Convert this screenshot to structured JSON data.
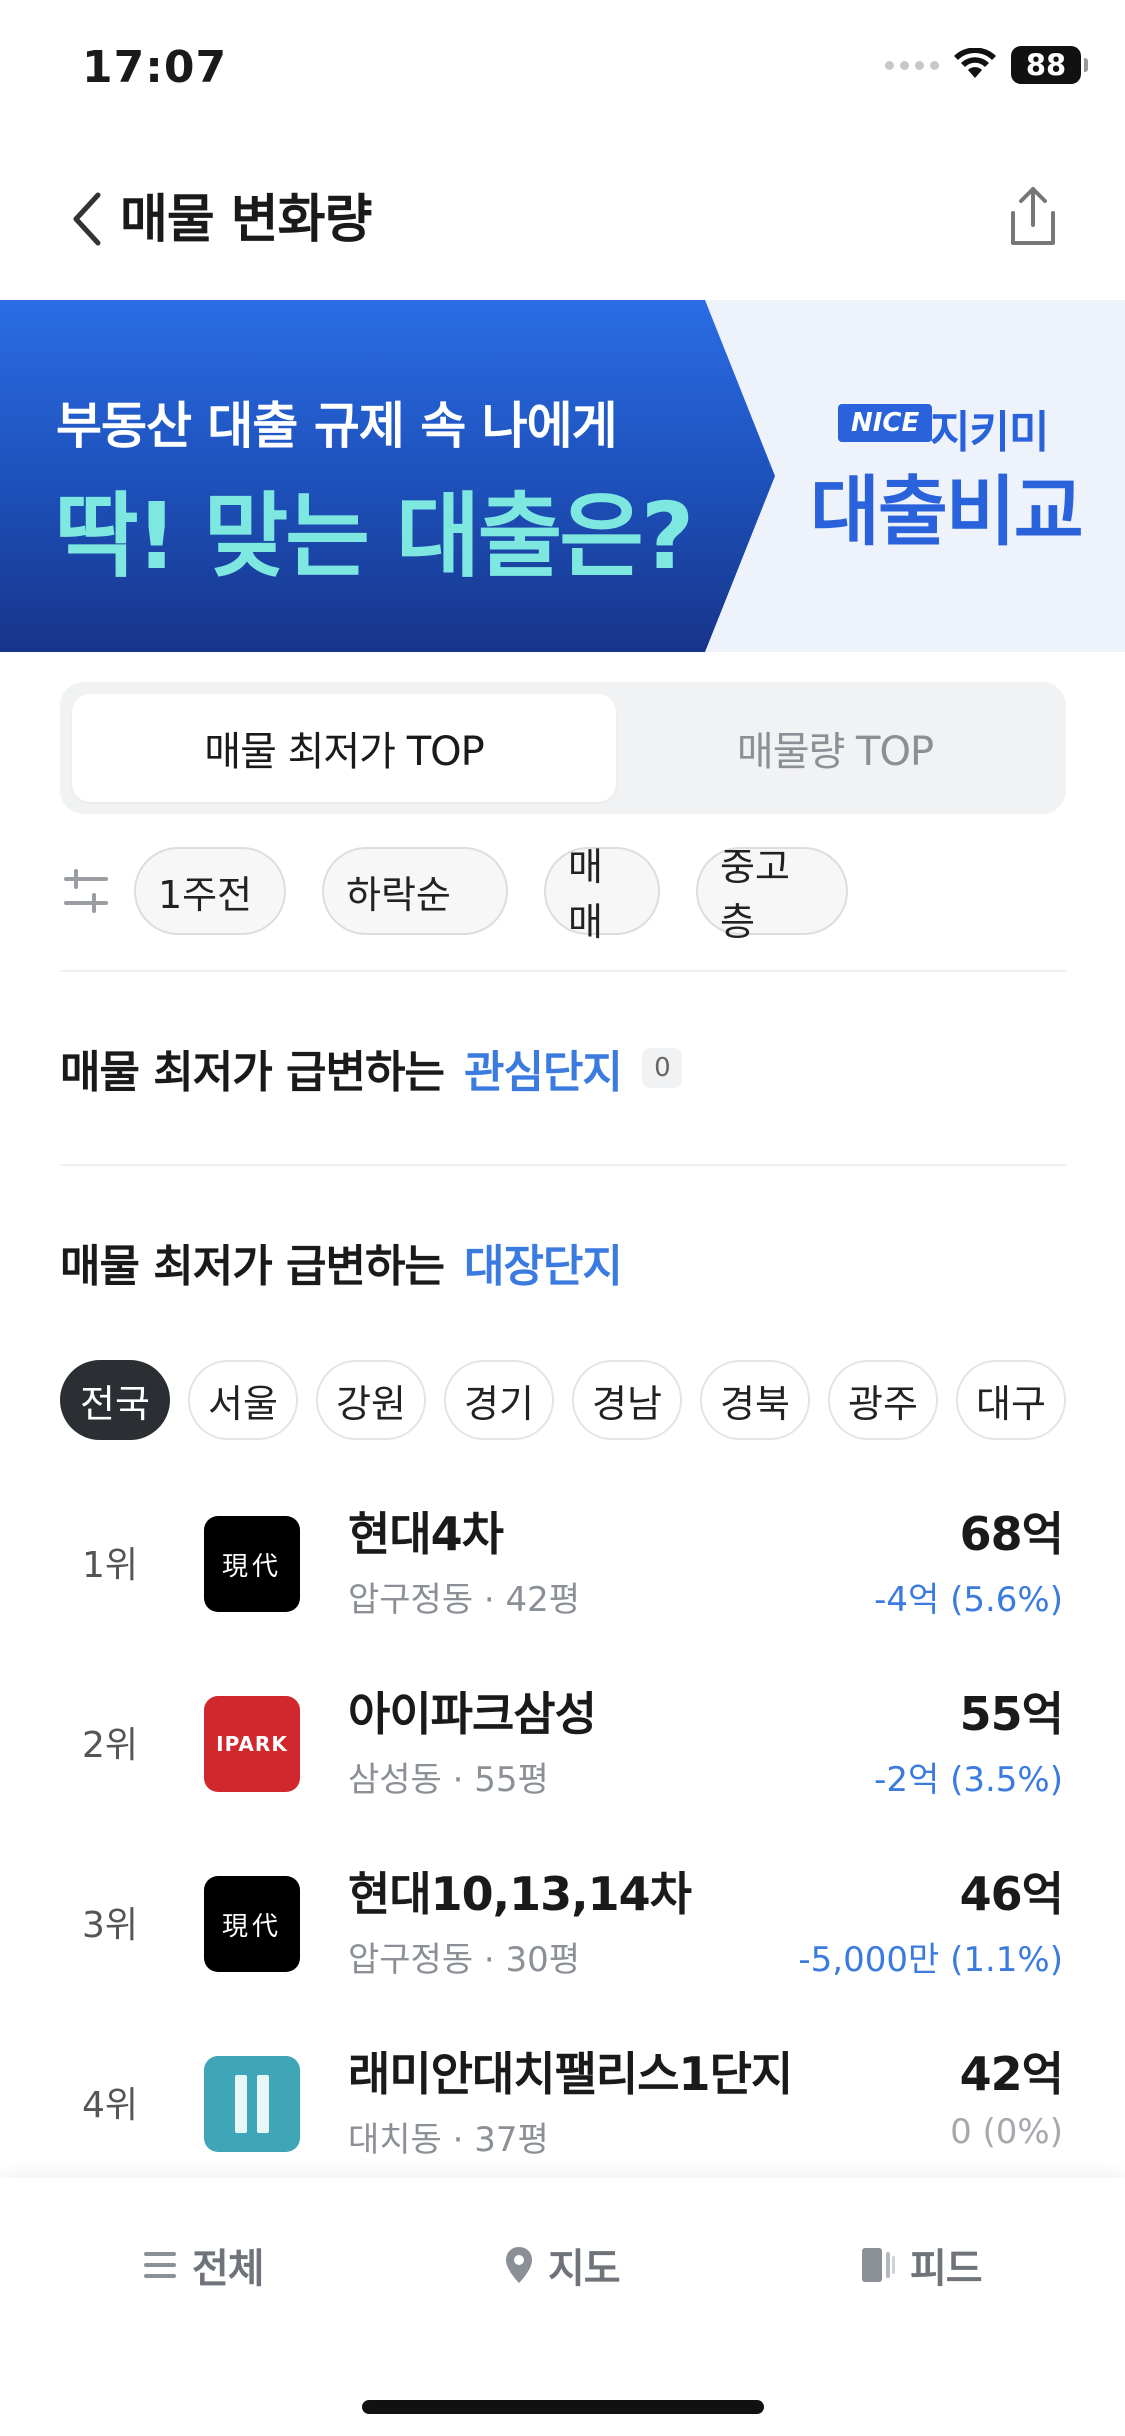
{
  "status_bar": {
    "time": "17:07",
    "battery": "88"
  },
  "header": {
    "title": "매물 변화량"
  },
  "banner": {
    "line1": "부동산 대출 규제 속 나에게",
    "line2": "딱! 맞는 대출은?",
    "brand_logo": "NICE",
    "brand_name": "지키미",
    "cta": "대출비교"
  },
  "tabs": [
    {
      "label": "매물 최저가 TOP",
      "active": true
    },
    {
      "label": "매물량 TOP",
      "active": false
    }
  ],
  "filters": [
    "1주전",
    "하락순",
    "매매",
    "중고층"
  ],
  "sections": {
    "interest": {
      "prefix": "매물 최저가 급변하는",
      "accent": "관심단지",
      "count": "0"
    },
    "major": {
      "prefix": "매물 최저가 급변하는",
      "accent": "대장단지"
    }
  },
  "regions": [
    "전국",
    "서울",
    "강원",
    "경기",
    "경남",
    "경북",
    "광주",
    "대구"
  ],
  "ranking": [
    {
      "rank": "1위",
      "logo": "現代",
      "name": "현대4차",
      "sub": "압구정동 · 42평",
      "price": "68억",
      "change": "-4억 (5.6%)"
    },
    {
      "rank": "2위",
      "logo": "IPARK",
      "name": "아이파크삼성",
      "sub": "삼성동 · 55평",
      "price": "55억",
      "change": "-2억 (3.5%)"
    },
    {
      "rank": "3위",
      "logo": "現代",
      "name": "현대10,13,14차",
      "sub": "압구정동 · 30평",
      "price": "46억",
      "change": "-5,000만 (1.1%)"
    },
    {
      "rank": "4위",
      "logo": "raemian-logo",
      "name": "래미안대치팰리스1단지",
      "sub": "대치동 · 37평",
      "price": "42억",
      "change": "0 (0%)"
    }
  ],
  "bottom_nav": [
    {
      "label": "전체",
      "icon": "menu-icon"
    },
    {
      "label": "지도",
      "icon": "map-pin-icon"
    },
    {
      "label": "피드",
      "icon": "feed-icon"
    }
  ],
  "colors": {
    "accent": "#3b7be0",
    "banner_blue": "#1d4fb8",
    "banner_mint": "#7ee8e0"
  }
}
